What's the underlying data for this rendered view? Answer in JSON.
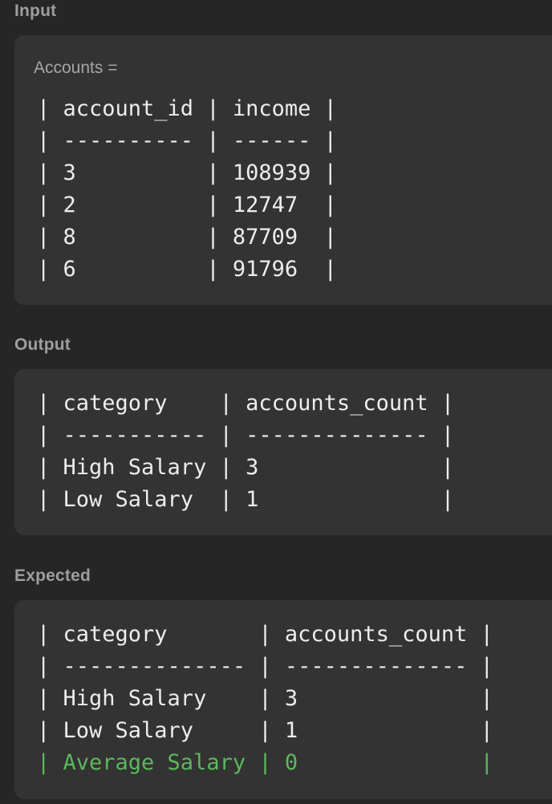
{
  "input": {
    "section_label": "Input",
    "variable_label": "Accounts =",
    "lines": [
      "| account_id | income |",
      "| ---------- | ------ |",
      "| 3          | 108939 |",
      "| 2          | 12747  |",
      "| 8          | 87709  |",
      "| 6          | 91796  |"
    ]
  },
  "output": {
    "section_label": "Output",
    "lines": [
      "| category    | accounts_count |",
      "| ----------- | -------------- |",
      "| High Salary | 3              |",
      "| Low Salary  | 1              |"
    ]
  },
  "expected": {
    "section_label": "Expected",
    "lines": [
      "| category       | accounts_count |",
      "| -------------- | -------------- |",
      "| High Salary    | 3              |",
      "| Low Salary     | 1              |",
      "| Average Salary | 0              |"
    ],
    "added_line_color": "#5cb85c"
  }
}
